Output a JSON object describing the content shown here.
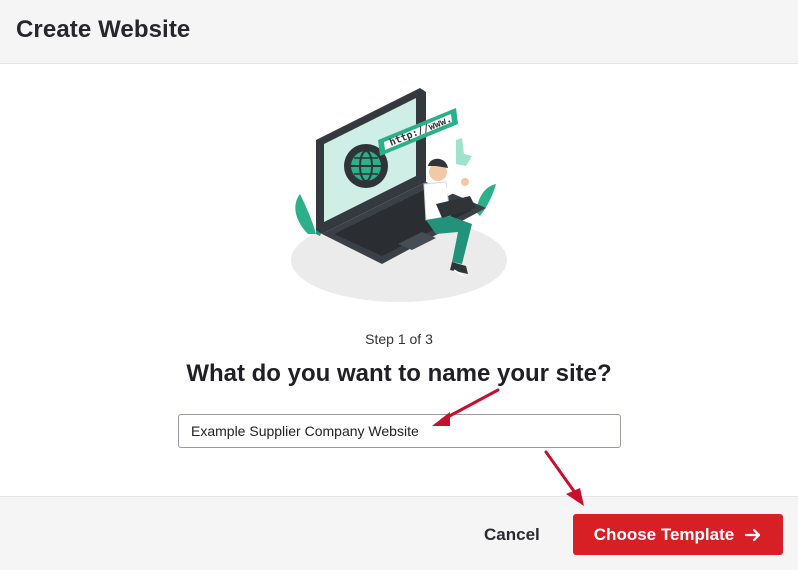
{
  "header": {
    "title": "Create Website"
  },
  "illustration": {
    "url_text": "http://www."
  },
  "step": {
    "label": "Step 1 of 3"
  },
  "question": {
    "text": "What do you want to name your site?"
  },
  "site_name": {
    "value": "Example Supplier Company Website"
  },
  "footer": {
    "cancel_label": "Cancel",
    "primary_label": "Choose Template"
  },
  "colors": {
    "brand": "#d91f26",
    "illustration_accent": "#2bb08a",
    "annotation_arrow": "#c8102e"
  }
}
